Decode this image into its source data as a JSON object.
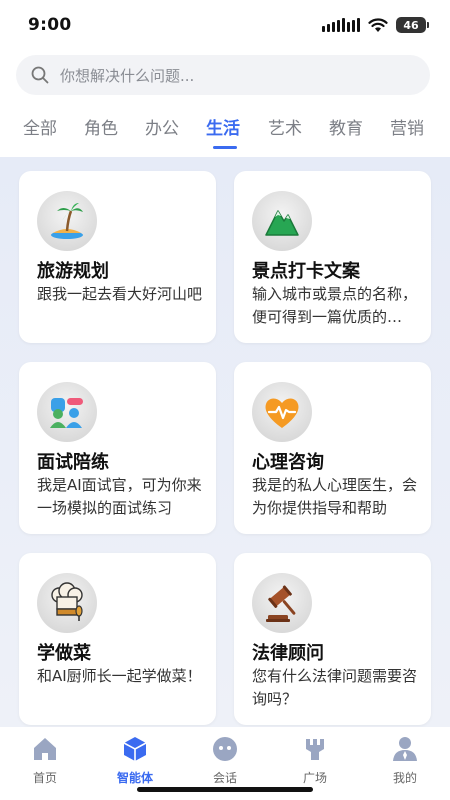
{
  "status": {
    "time": "9:00",
    "battery": "46"
  },
  "search": {
    "placeholder": "你想解决什么问题..."
  },
  "tabs": [
    {
      "label": "全部"
    },
    {
      "label": "角色"
    },
    {
      "label": "办公"
    },
    {
      "label": "生活",
      "active": true
    },
    {
      "label": "艺术"
    },
    {
      "label": "教育"
    },
    {
      "label": "营销"
    }
  ],
  "cards": [
    {
      "title": "旅游规划",
      "desc": "跟我一起去看大好河山吧",
      "icon": "palm-tree-island-icon"
    },
    {
      "title": "景点打卡文案",
      "desc": "输入城市或景点的名称，便可得到一篇优质的打卡文案",
      "icon": "green-mountain-icon"
    },
    {
      "title": "面试陪练",
      "desc": "我是AI面试官，可为你来一场模拟的面试练习",
      "icon": "interview-people-icon"
    },
    {
      "title": "心理咨询",
      "desc": "我是的私人心理医生，会为你提供指导和帮助",
      "icon": "heart-pulse-icon"
    },
    {
      "title": "学做菜",
      "desc": "和AI厨师长一起学做菜！",
      "icon": "chef-hat-icon"
    },
    {
      "title": "法律顾问",
      "desc": "您有什么法律问题需要咨询吗？",
      "icon": "judge-gavel-icon"
    }
  ],
  "nav": [
    {
      "label": "首页",
      "icon": "home-icon"
    },
    {
      "label": "智能体",
      "icon": "agent-cube-icon",
      "active": true
    },
    {
      "label": "会话",
      "icon": "chat-icon"
    },
    {
      "label": "广场",
      "icon": "plaza-icon"
    },
    {
      "label": "我的",
      "icon": "profile-icon"
    }
  ],
  "colors": {
    "accent": "#3b6bf0",
    "content_bg": "#e6ebf7",
    "nav_icon": "#9aa6c2"
  }
}
